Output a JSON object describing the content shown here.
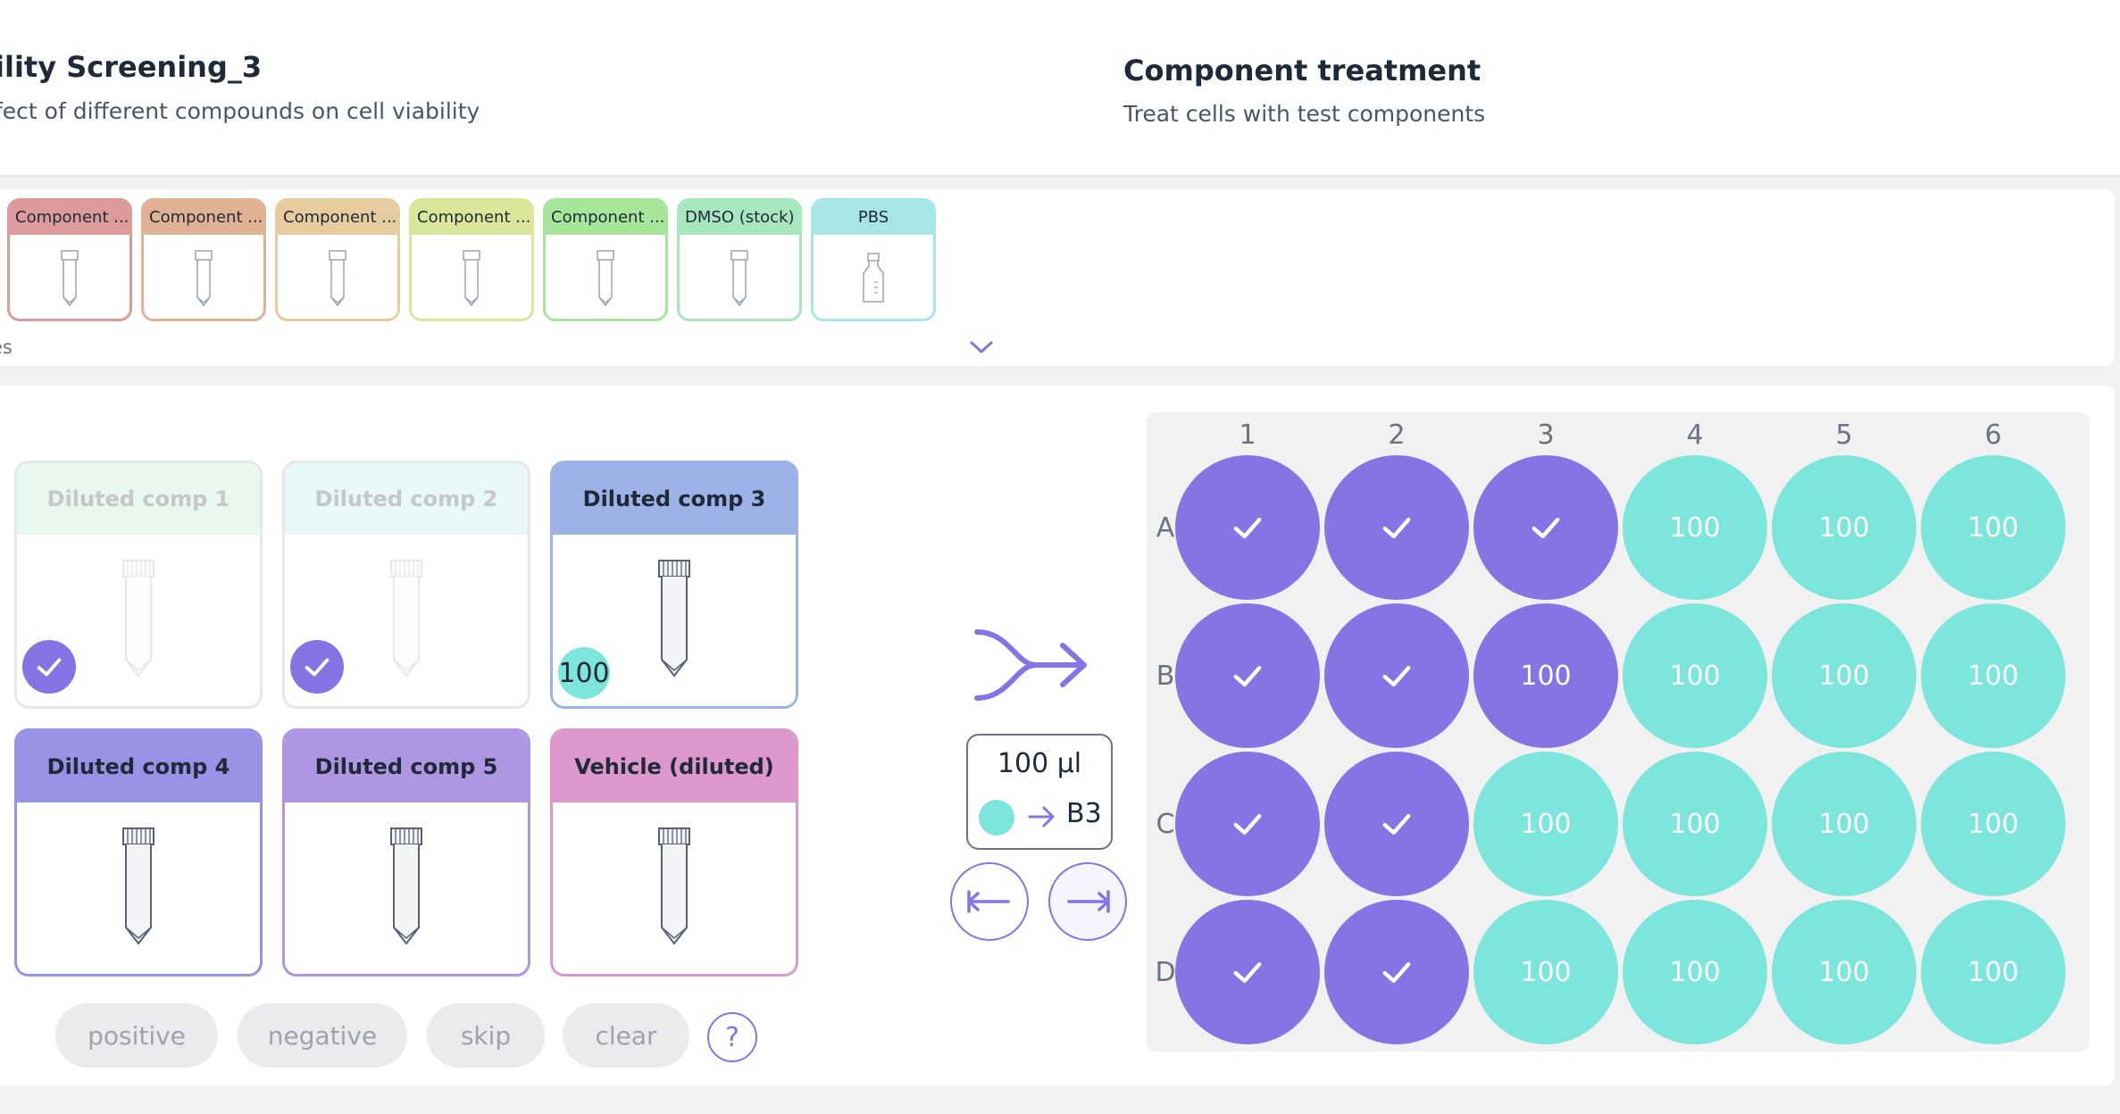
{
  "header": {
    "project_title": "ility Screening_3",
    "project_subtitle": "fect of different compounds on cell viability",
    "step_title": "Component treatment",
    "step_subtitle": "Treat cells with test components"
  },
  "reagents": {
    "items": [
      {
        "label": "Component ...",
        "color": "#dc9a9a",
        "icon": "tube-icon"
      },
      {
        "label": "Component ...",
        "color": "#e0b294",
        "icon": "tube-icon"
      },
      {
        "label": "Component ...",
        "color": "#e6cc9e",
        "icon": "tube-icon"
      },
      {
        "label": "Component ...",
        "color": "#d9e79b",
        "icon": "tube-icon"
      },
      {
        "label": "Component ...",
        "color": "#a6e69b",
        "icon": "tube-icon"
      },
      {
        "label": "DMSO (stock)",
        "color": "#a8e6bd",
        "icon": "tube-icon"
      },
      {
        "label": "PBS",
        "color": "#a8e6e6",
        "icon": "bottle-icon"
      }
    ],
    "more_label": "es"
  },
  "tubes": [
    {
      "label": "Diluted comp 1",
      "color": "#e9f8ef",
      "border": "#e6e7ea",
      "state": "done"
    },
    {
      "label": "Diluted comp 2",
      "color": "#e8f8f8",
      "border": "#e6e7ea",
      "state": "done"
    },
    {
      "label": "Diluted comp 3",
      "color": "#9cb1e6",
      "border": "#9cb1e6",
      "state": "active",
      "volume": "100"
    },
    {
      "label": "Diluted comp 4",
      "color": "#9891e6",
      "border": "#9891e6",
      "state": "idle"
    },
    {
      "label": "Diluted comp 5",
      "color": "#ae96e3",
      "border": "#ae96e3",
      "state": "idle"
    },
    {
      "label": "Vehicle (diluted)",
      "color": "#dc97cc",
      "border": "#dc97cc",
      "state": "idle"
    }
  ],
  "actions": {
    "positive": "positive",
    "negative": "negative",
    "skip": "skip",
    "clear": "clear",
    "help": "?"
  },
  "transfer": {
    "volume": "100 µl",
    "target_well": "B3"
  },
  "plate": {
    "columns": [
      "1",
      "2",
      "3",
      "4",
      "5",
      "6"
    ],
    "rows": [
      "A",
      "B",
      "C",
      "D"
    ],
    "wells": [
      [
        {
          "state": "check"
        },
        {
          "state": "check"
        },
        {
          "state": "check"
        },
        {
          "state": "teal",
          "value": "100"
        },
        {
          "state": "teal",
          "value": "100"
        },
        {
          "state": "teal",
          "value": "100"
        }
      ],
      [
        {
          "state": "check"
        },
        {
          "state": "check"
        },
        {
          "state": "purple",
          "value": "100"
        },
        {
          "state": "teal",
          "value": "100"
        },
        {
          "state": "teal",
          "value": "100"
        },
        {
          "state": "teal",
          "value": "100"
        }
      ],
      [
        {
          "state": "check"
        },
        {
          "state": "check"
        },
        {
          "state": "teal",
          "value": "100"
        },
        {
          "state": "teal",
          "value": "100"
        },
        {
          "state": "teal",
          "value": "100"
        },
        {
          "state": "teal",
          "value": "100"
        }
      ],
      [
        {
          "state": "check"
        },
        {
          "state": "check"
        },
        {
          "state": "teal",
          "value": "100"
        },
        {
          "state": "teal",
          "value": "100"
        },
        {
          "state": "teal",
          "value": "100"
        },
        {
          "state": "teal",
          "value": "100"
        }
      ]
    ]
  },
  "colors": {
    "accent": "#8474e4",
    "teal": "#7de6dc"
  }
}
